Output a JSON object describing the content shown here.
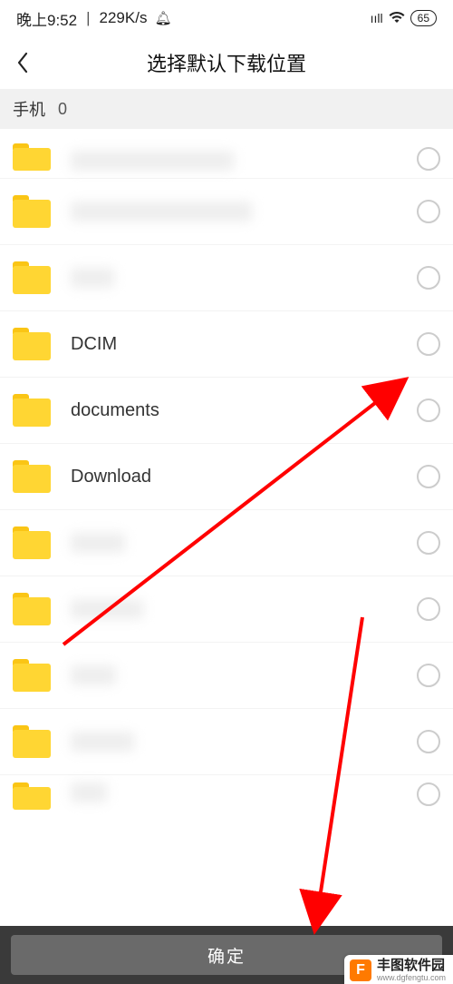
{
  "status": {
    "time": "晚上9:52",
    "speed": "229K/s",
    "battery": "65"
  },
  "header": {
    "title": "选择默认下载位置"
  },
  "crumb": {
    "root": "手机",
    "count": "0"
  },
  "folders": [
    {
      "name": "",
      "blurred": true,
      "blur_w": 180
    },
    {
      "name": "",
      "blurred": true,
      "blur_w": 200
    },
    {
      "name": "",
      "blurred": true,
      "blur_w": 48
    },
    {
      "name": "DCIM",
      "blurred": false
    },
    {
      "name": "documents",
      "blurred": false
    },
    {
      "name": "Download",
      "blurred": false
    },
    {
      "name": "",
      "blurred": true,
      "blur_w": 60
    },
    {
      "name": "",
      "blurred": true,
      "blur_w": 80
    },
    {
      "name": "",
      "blurred": true,
      "blur_w": 50
    },
    {
      "name": "",
      "blurred": true,
      "blur_w": 70
    },
    {
      "name": "",
      "blurred": true,
      "blur_w": 40
    }
  ],
  "bottom": {
    "confirm": "确定"
  },
  "watermark": {
    "name": "丰图软件园",
    "url": "www.dgfengtu.com"
  }
}
